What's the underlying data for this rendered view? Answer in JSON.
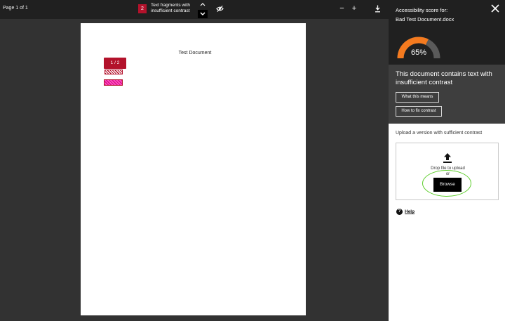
{
  "toolbar": {
    "page_indicator": "Page 1 of 1",
    "issue_count": "2",
    "issue_label": "Text fragments with insufficient contrast",
    "zoom_out": "−",
    "zoom_in": "+",
    "icons": [
      "chevron-up-icon",
      "chevron-down-icon",
      "eye-off-icon",
      "download-icon"
    ]
  },
  "document": {
    "title": "Test Document",
    "marker_label": "1 / 2",
    "marker_color": "#b3122b",
    "fragment_colors": [
      "#b3122b",
      "#e0118f"
    ]
  },
  "sidebar": {
    "score_for": "Accessibility score for:",
    "file_name": "Bad Test Document.docx",
    "score_value": "65%",
    "score_fraction": 0.65,
    "gauge_color": "#f47a1f",
    "headline": "This document contains text with insufficient contrast",
    "what_means_label": "What this means",
    "how_fix_label": "How to fix contrast",
    "upload_label": "Upload a version with sufficient contrast",
    "drop_text": "Drop file to upload",
    "or_text": "or",
    "browse_label": "Browse",
    "help_label": "Help",
    "highlight_color": "#5ccd2a"
  }
}
